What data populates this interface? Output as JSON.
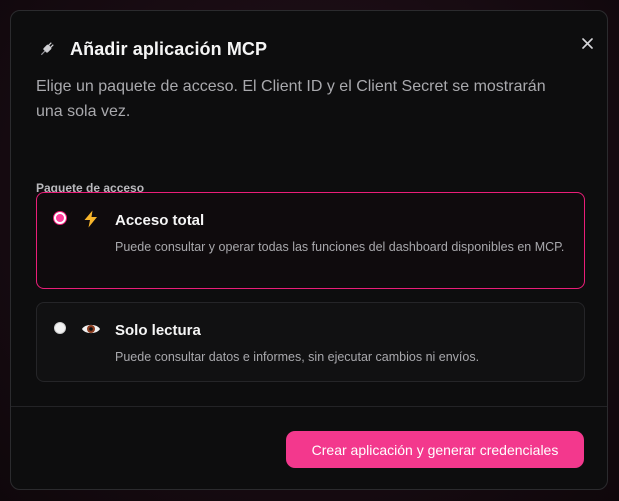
{
  "dialog": {
    "title": "Añadir aplicación MCP",
    "title_icon": "plug-icon",
    "subtitle": "Elige un paquete de acceso. El Client ID y el Client Secret se mostrarán una sola vez.",
    "close_icon": "close-icon"
  },
  "access_package": {
    "label": "Paquete de acceso",
    "options": [
      {
        "title": "Acceso total",
        "description": "Puede consultar y operar todas las funciones del dashboard disponibles en MCP.",
        "icon": "lightning-icon",
        "selected": true
      },
      {
        "title": "Solo lectura",
        "description": "Puede consultar datos e informes, sin ejecutar cambios ni envíos.",
        "icon": "eye-icon",
        "selected": false
      }
    ]
  },
  "footer": {
    "primary_label": "Crear aplicación y generar credenciales"
  },
  "colors": {
    "accent": "#f3388d",
    "selected_border": "#e91e78",
    "modal_bg": "#0d0d0e"
  }
}
